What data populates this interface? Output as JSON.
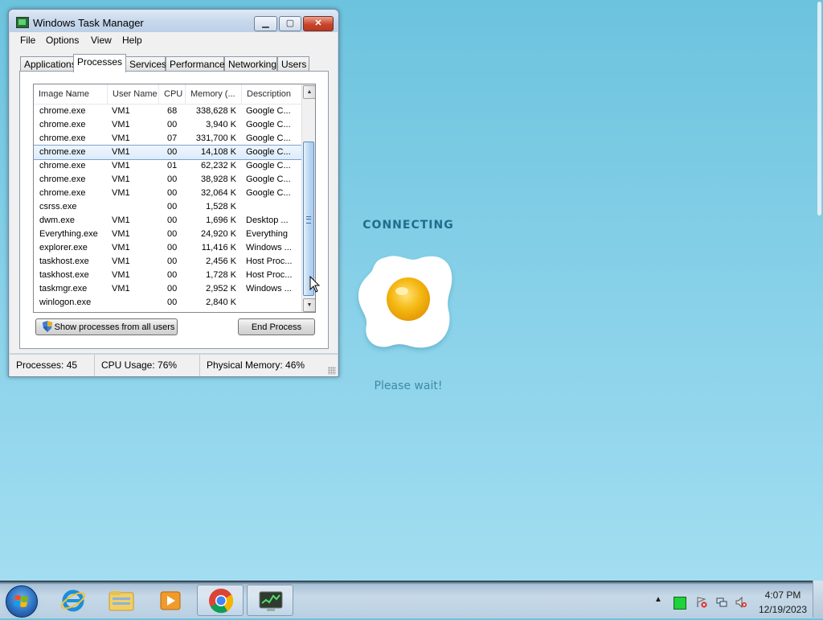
{
  "background_page": {
    "heading": "CONNECTING",
    "message": "Please wait!"
  },
  "task_manager": {
    "title": "Windows Task Manager",
    "window_buttons": {
      "minimize": "▁",
      "maximize": "▢",
      "close": "✕"
    },
    "menu": [
      "File",
      "Options",
      "View",
      "Help"
    ],
    "tabs": [
      "Applications",
      "Processes",
      "Services",
      "Performance",
      "Networking",
      "Users"
    ],
    "active_tab": "Processes",
    "columns": [
      "Image Name",
      "User Name",
      "CPU",
      "Memory (...",
      "Description"
    ],
    "rows": [
      {
        "name": "chrome.exe",
        "user": "VM1",
        "cpu": "68",
        "mem": "338,628 K",
        "desc": "Google C..."
      },
      {
        "name": "chrome.exe",
        "user": "VM1",
        "cpu": "00",
        "mem": "3,940 K",
        "desc": "Google C..."
      },
      {
        "name": "chrome.exe",
        "user": "VM1",
        "cpu": "07",
        "mem": "331,700 K",
        "desc": "Google C..."
      },
      {
        "name": "chrome.exe",
        "user": "VM1",
        "cpu": "00",
        "mem": "14,108 K",
        "desc": "Google C..."
      },
      {
        "name": "chrome.exe",
        "user": "VM1",
        "cpu": "01",
        "mem": "62,232 K",
        "desc": "Google C..."
      },
      {
        "name": "chrome.exe",
        "user": "VM1",
        "cpu": "00",
        "mem": "38,928 K",
        "desc": "Google C..."
      },
      {
        "name": "chrome.exe",
        "user": "VM1",
        "cpu": "00",
        "mem": "32,064 K",
        "desc": "Google C..."
      },
      {
        "name": "csrss.exe",
        "user": "",
        "cpu": "00",
        "mem": "1,528 K",
        "desc": ""
      },
      {
        "name": "dwm.exe",
        "user": "VM1",
        "cpu": "00",
        "mem": "1,696 K",
        "desc": "Desktop ..."
      },
      {
        "name": "Everything.exe",
        "user": "VM1",
        "cpu": "00",
        "mem": "24,920 K",
        "desc": "Everything"
      },
      {
        "name": "explorer.exe",
        "user": "VM1",
        "cpu": "00",
        "mem": "11,416 K",
        "desc": "Windows ..."
      },
      {
        "name": "taskhost.exe",
        "user": "VM1",
        "cpu": "00",
        "mem": "2,456 K",
        "desc": "Host Proc..."
      },
      {
        "name": "taskhost.exe",
        "user": "VM1",
        "cpu": "00",
        "mem": "1,728 K",
        "desc": "Host Proc..."
      },
      {
        "name": "taskmgr.exe",
        "user": "VM1",
        "cpu": "00",
        "mem": "2,952 K",
        "desc": "Windows ..."
      },
      {
        "name": "winlogon.exe",
        "user": "",
        "cpu": "00",
        "mem": "2,840 K",
        "desc": ""
      }
    ],
    "selected_row_index": 3,
    "buttons": {
      "show_all": "Show processes from all users",
      "end_process": "End Process"
    },
    "status": {
      "processes": "Processes: 45",
      "cpu": "CPU Usage: 76%",
      "memory": "Physical Memory: 46%"
    }
  },
  "taskbar": {
    "pinned": [
      "windows-start-orb",
      "internet-explorer-icon",
      "windows-explorer-icon",
      "media-player-icon",
      "chrome-icon",
      "task-manager-icon"
    ],
    "clock_time": "4:07 PM",
    "clock_date": "12/19/2023"
  },
  "colors": {
    "accent_connecting": "#1f6d8a",
    "selection": "#dcebfc",
    "egg_yolk": "#f2b511"
  }
}
